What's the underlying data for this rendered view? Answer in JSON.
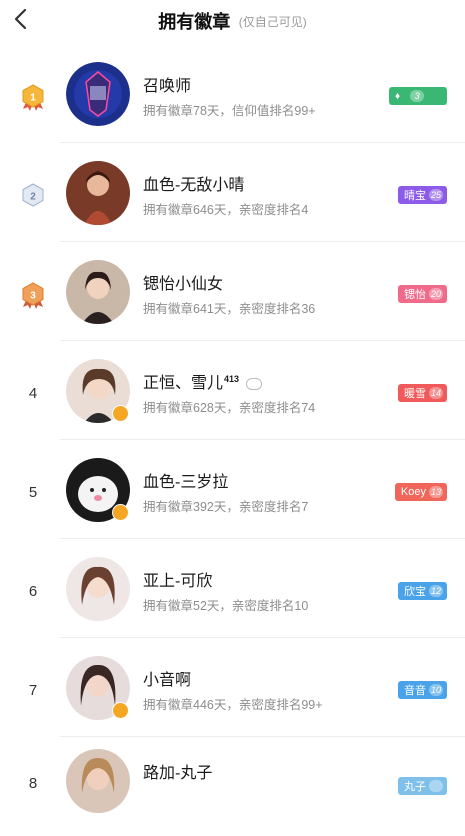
{
  "header": {
    "title": "拥有徽章",
    "subtitle": "(仅自己可见)"
  },
  "rows": [
    {
      "rank": "1",
      "name": "召唤师",
      "sup": "",
      "meta": "拥有徽章78天，信仰值排名99+",
      "badge_text": "",
      "badge_level": "3",
      "badge_color": "#3ab873",
      "medal": "gold"
    },
    {
      "rank": "2",
      "name": "血色-无敌小晴",
      "sup": "",
      "meta": "拥有徽章646天，亲密度排名4",
      "badge_text": "晴宝",
      "badge_level": "25",
      "badge_color": "#8c5be8",
      "medal": "silver"
    },
    {
      "rank": "3",
      "name": "锶怡小仙女",
      "sup": "",
      "meta": "拥有徽章641天，亲密度排名36",
      "badge_text": "锶怡",
      "badge_level": "20",
      "badge_color": "#f06a8a",
      "medal": "bronze"
    },
    {
      "rank": "4",
      "name": "正恒、雪儿",
      "sup": "413",
      "meta": "拥有徽章628天，亲密度排名74",
      "badge_text": "暖雪",
      "badge_level": "14",
      "badge_color": "#f05a5a",
      "medal": ""
    },
    {
      "rank": "5",
      "name": "血色-三岁拉",
      "sup": "",
      "meta": "拥有徽章392天，亲密度排名7",
      "badge_text": "Koey",
      "badge_level": "13",
      "badge_color": "#f0665a",
      "medal": ""
    },
    {
      "rank": "6",
      "name": "亚上-可欣",
      "sup": "",
      "meta": "拥有徽章52天，亲密度排名10",
      "badge_text": "欣宝",
      "badge_level": "12",
      "badge_color": "#4aa3e8",
      "medal": ""
    },
    {
      "rank": "7",
      "name": "小音啊",
      "sup": "",
      "meta": "拥有徽章446天，亲密度排名99+",
      "badge_text": "音音",
      "badge_level": "10",
      "badge_color": "#4aa3e8",
      "medal": ""
    },
    {
      "rank": "8",
      "name": "路加-丸子",
      "sup": "",
      "meta": "",
      "badge_text": "丸子",
      "badge_level": "",
      "badge_color": "#7fc0ea",
      "medal": ""
    }
  ]
}
